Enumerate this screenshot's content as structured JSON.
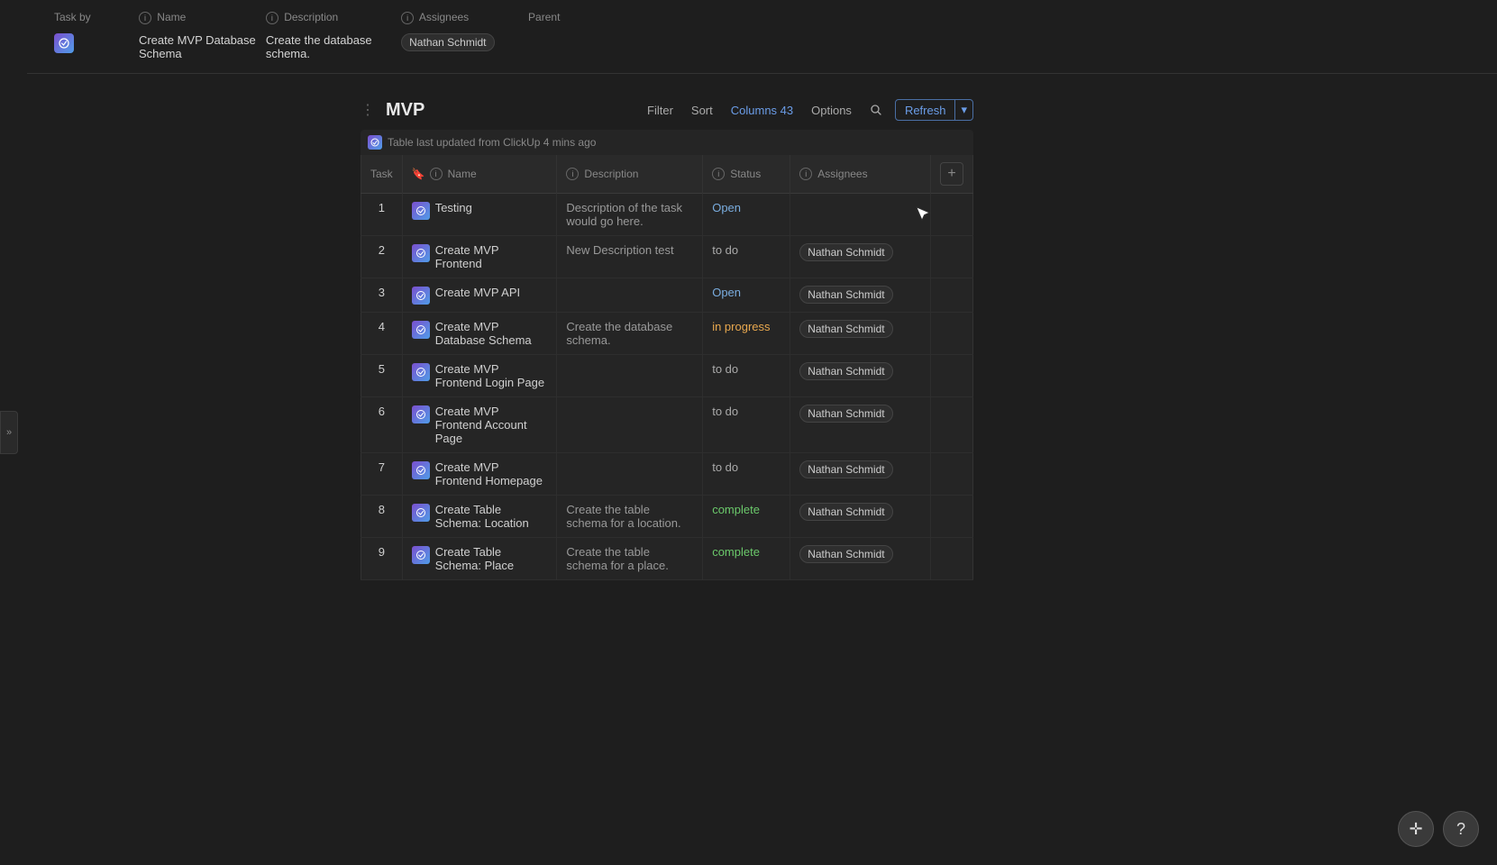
{
  "sidebar": {
    "toggle_label": "»"
  },
  "top_section": {
    "label": "Task by",
    "columns": [
      "Name",
      "Description",
      "Assignees",
      "Parent"
    ],
    "row": {
      "name": "Create MVP Database Schema",
      "description": "Create the database schema.",
      "assignee": "Nathan Schmidt"
    }
  },
  "mvp": {
    "title": "MVP",
    "toolbar": {
      "filter_label": "Filter",
      "sort_label": "Sort",
      "columns_label": "Columns 43",
      "options_label": "Options",
      "refresh_label": "Refresh"
    },
    "update_info": "Table last updated from ClickUp 4 mins ago",
    "table": {
      "columns": [
        "Task",
        "Name",
        "Description",
        "Status",
        "Assignees",
        "+"
      ],
      "rows": [
        {
          "num": "1",
          "name": "Testing",
          "description": "Description of the task would go here.",
          "status": "Open",
          "assignee": ""
        },
        {
          "num": "2",
          "name": "Create MVP Frontend",
          "description": "New Description test",
          "status": "to do",
          "assignee": "Nathan Schmidt"
        },
        {
          "num": "3",
          "name": "Create MVP API",
          "description": "",
          "status": "Open",
          "assignee": "Nathan Schmidt"
        },
        {
          "num": "4",
          "name": "Create MVP Database Schema",
          "description": "Create the database schema.",
          "status": "in progress",
          "assignee": "Nathan Schmidt"
        },
        {
          "num": "5",
          "name": "Create MVP Frontend Login Page",
          "description": "",
          "status": "to do",
          "assignee": "Nathan Schmidt"
        },
        {
          "num": "6",
          "name": "Create MVP Frontend Account Page",
          "description": "",
          "status": "to do",
          "assignee": "Nathan Schmidt"
        },
        {
          "num": "7",
          "name": "Create MVP Frontend Homepage",
          "description": "",
          "status": "to do",
          "assignee": "Nathan Schmidt"
        },
        {
          "num": "8",
          "name": "Create Table Schema: Location",
          "description": "Create the table schema for a location.",
          "status": "complete",
          "assignee": "Nathan Schmidt"
        },
        {
          "num": "9",
          "name": "Create Table Schema: Place",
          "description": "Create the table schema for a place.",
          "status": "complete",
          "assignee": "Nathan Schmidt"
        }
      ]
    }
  },
  "bottom_buttons": {
    "plus_label": "+",
    "help_label": "?"
  }
}
